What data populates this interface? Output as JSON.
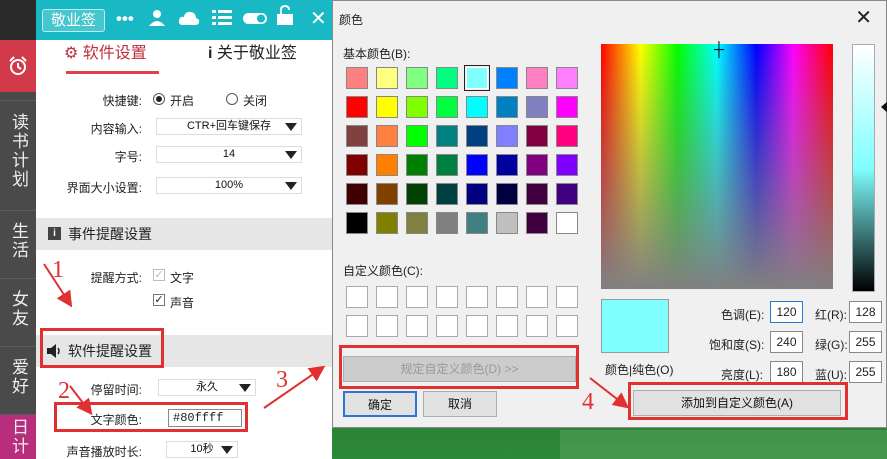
{
  "app": {
    "title": "敬业签",
    "header_icons": [
      "more-icon",
      "user-icon",
      "cloud-icon",
      "list-icon",
      "toggle-icon",
      "unlock-icon",
      "close-icon"
    ],
    "tabs": [
      {
        "label": "软件设置",
        "icon": "gear-icon",
        "active": true
      },
      {
        "label": "关于敬业签",
        "icon": "info-icon",
        "active": false
      }
    ],
    "settings": {
      "hotkey_label": "快捷键:",
      "hotkey_on": "开启",
      "hotkey_off": "关闭",
      "input_label": "内容输入:",
      "input_value": "CTR+回车键保存",
      "font_label": "字号:",
      "font_value": "14",
      "ui_size_label": "界面大小设置:",
      "ui_size_value": "100%"
    },
    "event_section": "事件提醒设置",
    "reminder": {
      "method_label": "提醒方式:",
      "text_option": "文字",
      "sound_option": "声音"
    },
    "software_section": "软件提醒设置",
    "software": {
      "duration_label": "停留时间:",
      "duration_value": "永久",
      "text_color_label": "文字颜色:",
      "text_color_value": "#80ffff",
      "sound_duration_label": "声音播放时长:",
      "sound_duration_value": "10秒"
    },
    "sidebar": [
      "读书计划",
      "生活",
      "女友",
      "爱好",
      "日计"
    ]
  },
  "annotations": [
    "1",
    "2",
    "3",
    "4"
  ],
  "dialog": {
    "title": "颜色",
    "basic_label": "基本颜色(B):",
    "custom_label": "自定义颜色(C):",
    "define_button": "规定自定义颜色(D) >>",
    "ok_button": "确定",
    "cancel_button": "取消",
    "add_button": "添加到自定义颜色(A)",
    "color_solid_label": "颜色|纯色(O)",
    "hue_label": "色调(E):",
    "hue_value": "120",
    "sat_label": "饱和度(S):",
    "sat_value": "240",
    "lum_label": "亮度(L):",
    "lum_value": "180",
    "red_label": "红(R):",
    "red_value": "128",
    "green_label": "绿(G):",
    "green_value": "255",
    "blue_label": "蓝(U):",
    "blue_value": "255",
    "selected_color": "#80ffff",
    "basic_colors": [
      "#ff8080",
      "#ffff80",
      "#80ff80",
      "#00ff80",
      "#80ffff",
      "#0080ff",
      "#ff80c0",
      "#ff80ff",
      "#ff0000",
      "#ffff00",
      "#80ff00",
      "#00ff40",
      "#00ffff",
      "#0080c0",
      "#8080c0",
      "#ff00ff",
      "#804040",
      "#ff8040",
      "#00ff00",
      "#008080",
      "#004080",
      "#8080ff",
      "#800040",
      "#ff0080",
      "#800000",
      "#ff8000",
      "#008000",
      "#008040",
      "#0000ff",
      "#0000a0",
      "#800080",
      "#8000ff",
      "#400000",
      "#804000",
      "#004000",
      "#004040",
      "#000080",
      "#000040",
      "#400040",
      "#400080",
      "#000000",
      "#808000",
      "#808040",
      "#808080",
      "#408080",
      "#c0c0c0",
      "#400040",
      "#ffffff"
    ]
  }
}
